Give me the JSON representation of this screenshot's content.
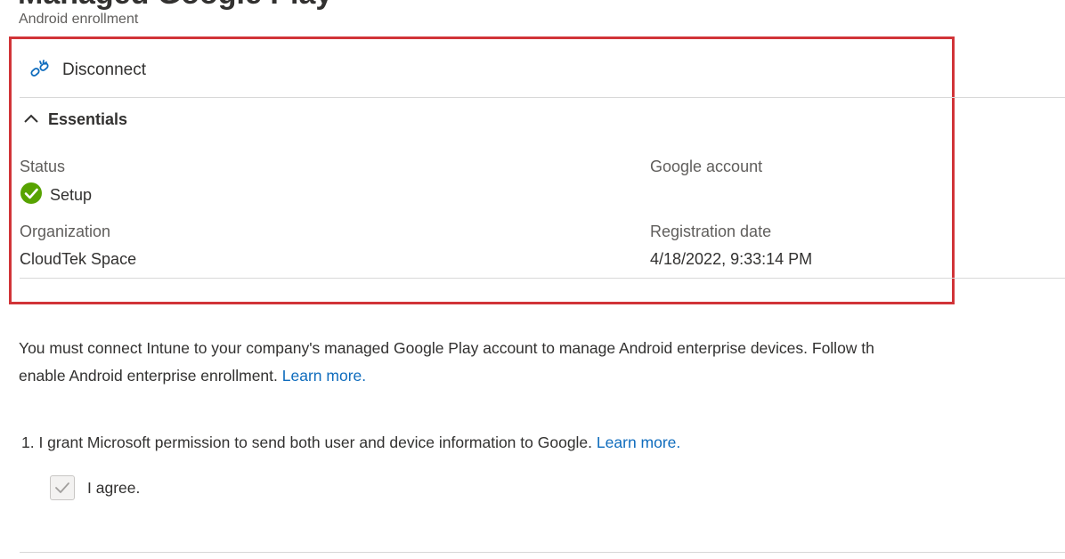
{
  "header": {
    "title": "Managed Google Play",
    "subtitle": "Android enrollment"
  },
  "command_bar": {
    "disconnect_label": "Disconnect",
    "disconnect_icon": "link-disconnect-icon"
  },
  "essentials": {
    "label": "Essentials",
    "toggle_icon": "chevron-up-icon",
    "fields": {
      "status": {
        "label": "Status",
        "value": "Setup",
        "icon": "check-circle-icon",
        "icon_color": "#57a300"
      },
      "google_account": {
        "label": "Google account",
        "value": ""
      },
      "organization": {
        "label": "Organization",
        "value": "CloudTek Space"
      },
      "registration_date": {
        "label": "Registration date",
        "value": "4/18/2022, 9:33:14 PM"
      }
    }
  },
  "description": {
    "line1": "You must connect Intune to your company's managed Google Play account to manage Android enterprise devices. Follow th",
    "line2": "enable Android enterprise enrollment.",
    "learn_more": "Learn more."
  },
  "steps": [
    {
      "text": "1. I grant Microsoft permission to send both user and device information to Google.",
      "learn_more": "Learn more.",
      "checkbox_label": "I agree.",
      "checked": true
    }
  ],
  "colors": {
    "highlight_border": "#d13438",
    "link": "#0f6cbd",
    "success": "#57a300",
    "icon_blue": "#0f6cbd"
  }
}
